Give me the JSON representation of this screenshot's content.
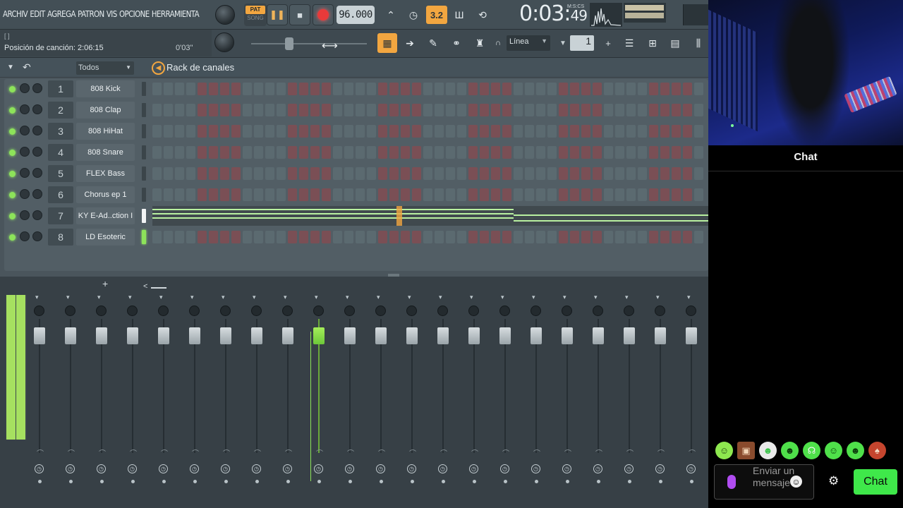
{
  "menu": [
    "ARCHIV",
    "EDIT",
    "AGREGA",
    "PATRON",
    "VIS",
    "OPCIONE",
    "HERRAMIENTA"
  ],
  "transport": {
    "pat_label": "PAT",
    "song_label": "SONG",
    "tempo": "96.000",
    "time_main": "0:03:",
    "time_small": "49",
    "time_unit": "M:S:CS",
    "beat_badge": "3.2"
  },
  "hint_bar": {
    "top": "[ ]",
    "position_text": "Posición de canción: 2:06:15",
    "time_code": "0'03\""
  },
  "snap": {
    "value": "Línea"
  },
  "step": {
    "value": "1",
    "minus": "-",
    "plus": "+"
  },
  "rack": {
    "filter": "Todos",
    "title": "Rack de canales",
    "channels": [
      {
        "num": "1",
        "name": "808 Kick"
      },
      {
        "num": "2",
        "name": "808 Clap"
      },
      {
        "num": "3",
        "name": "808 HiHat"
      },
      {
        "num": "4",
        "name": "808 Snare"
      },
      {
        "num": "5",
        "name": "FLEX Bass"
      },
      {
        "num": "6",
        "name": "Chorus ep 1"
      },
      {
        "num": "7",
        "name": "KY E-Ad..ction I"
      },
      {
        "num": "8",
        "name": "LD Esoteric"
      }
    ]
  },
  "mixer": {
    "add": "+",
    "collapse": "<"
  },
  "chat": {
    "title": "Chat",
    "input_placeholder": "Enviar un mensaje",
    "send_label": "Chat"
  },
  "colors": {
    "accent": "#f2a640",
    "led": "#8de35a",
    "chat_button": "#3fe84a",
    "step_dark": "#5b6a70",
    "step_red": "#7a4f55"
  }
}
